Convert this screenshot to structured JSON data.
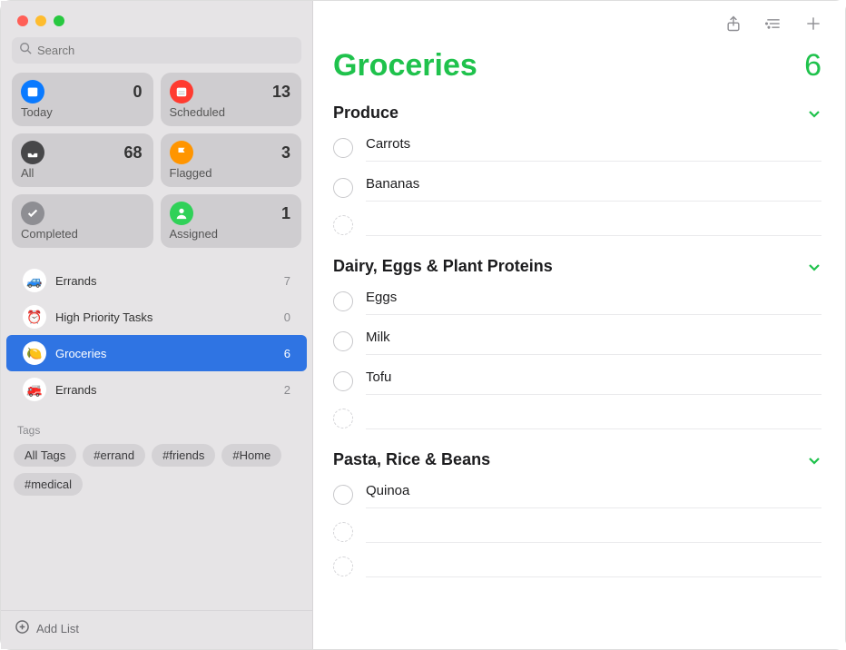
{
  "search": {
    "placeholder": "Search"
  },
  "smart_cards": [
    {
      "id": "today",
      "label": "Today",
      "count": 0,
      "color": "#0a7aff",
      "icon": "calendar"
    },
    {
      "id": "scheduled",
      "label": "Scheduled",
      "count": 13,
      "color": "#ff3b30",
      "icon": "calendar-lines"
    },
    {
      "id": "all",
      "label": "All",
      "count": 68,
      "color": "#474749",
      "icon": "tray"
    },
    {
      "id": "flagged",
      "label": "Flagged",
      "count": 3,
      "color": "#ff9500",
      "icon": "flag"
    },
    {
      "id": "completed",
      "label": "Completed",
      "count": "",
      "color": "#8e8e93",
      "icon": "check"
    },
    {
      "id": "assigned",
      "label": "Assigned",
      "count": 1,
      "color": "#30d158",
      "icon": "person"
    }
  ],
  "lists": [
    {
      "id": "errands1",
      "label": "Errands",
      "count": 7,
      "emoji": "🚙",
      "selected": false
    },
    {
      "id": "high",
      "label": "High Priority Tasks",
      "count": 0,
      "emoji": "⏰",
      "selected": false
    },
    {
      "id": "groceries",
      "label": "Groceries",
      "count": 6,
      "emoji": "🍋",
      "selected": true
    },
    {
      "id": "errands2",
      "label": "Errands",
      "count": 2,
      "emoji": "🚒",
      "selected": false
    }
  ],
  "tags_title": "Tags",
  "tags": [
    "All Tags",
    "#errand",
    "#friends",
    "#Home",
    "#medical"
  ],
  "add_list_label": "Add List",
  "list_title": "Groceries",
  "list_count": 6,
  "accent": "#1fc24c",
  "sections": [
    {
      "title": "Produce",
      "items": [
        "Carrots",
        "Bananas"
      ]
    },
    {
      "title": "Dairy, Eggs & Plant Proteins",
      "items": [
        "Eggs",
        "Milk",
        "Tofu"
      ]
    },
    {
      "title": "Pasta, Rice & Beans",
      "items": [
        "Quinoa"
      ]
    }
  ]
}
